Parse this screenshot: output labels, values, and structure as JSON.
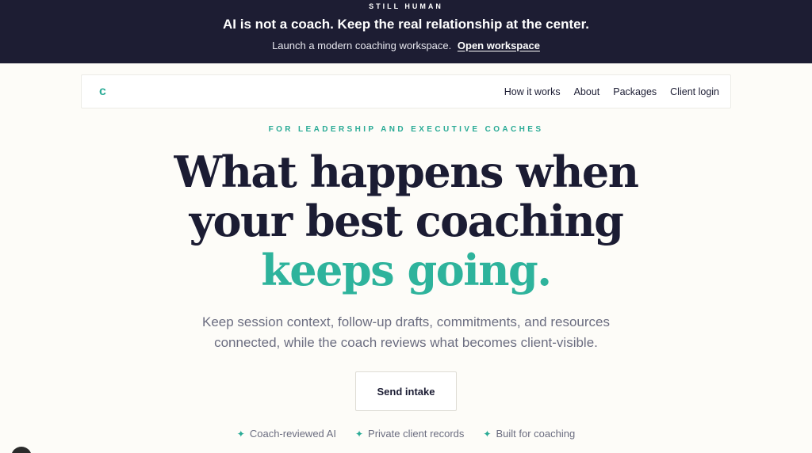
{
  "banner": {
    "eyebrow": "STILL HUMAN",
    "title": "AI is not a coach. Keep the real relationship at the center.",
    "subtitle": "Launch a modern coaching workspace.",
    "link": "Open workspace"
  },
  "nav": {
    "logo": "c",
    "links": [
      "How it works",
      "About",
      "Packages",
      "Client login"
    ]
  },
  "hero": {
    "eyebrow": "FOR LEADERSHIP AND EXECUTIVE COACHES",
    "headline_line1": "What happens when",
    "headline_line2": "your best coaching",
    "headline_accent": "keeps going.",
    "lede_line1": "Keep session context, follow-up drafts, commitments, and resources",
    "lede_line2": "connected, while the coach reviews what becomes client-visible.",
    "cta": "Send intake"
  },
  "features": [
    {
      "icon": "sparkle-icon",
      "label": "Coach-reviewed AI"
    },
    {
      "icon": "sparkle-icon",
      "label": "Private client records"
    },
    {
      "icon": "sparkle-icon",
      "label": "Built for coaching"
    }
  ],
  "colors": {
    "banner_bg": "#1d1d33",
    "accent": "#2eb39c",
    "page_bg": "#fdfcf8"
  }
}
